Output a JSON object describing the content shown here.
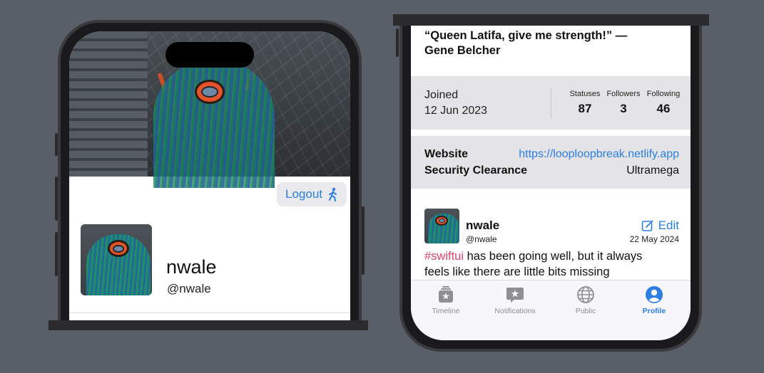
{
  "left": {
    "logout_label": "Logout",
    "profile_name": "nwale",
    "profile_handle": "@nwale"
  },
  "right": {
    "quote_line1": "“Queen Latifa, give me strength!” —",
    "quote_line2": "Gene Belcher",
    "joined_label": "Joined",
    "joined_date": "12 Jun 2023",
    "stats": [
      {
        "label": "Statuses",
        "value": "87"
      },
      {
        "label": "Followers",
        "value": "3"
      },
      {
        "label": "Following",
        "value": "46"
      }
    ],
    "fields": [
      {
        "key": "Website",
        "value": "https://looploopbreak.netlify.app"
      },
      {
        "key": "Security Clearance",
        "value": "Ultramega"
      }
    ],
    "post": {
      "author": "nwale",
      "handle": "@nwale",
      "edit_label": "Edit",
      "date": "22 May 2024",
      "hashtag": "#swiftui",
      "text": " has been going well, but it always feels like there are little bits missing"
    },
    "tabs": [
      {
        "label": "Timeline",
        "icon": "timeline-icon"
      },
      {
        "label": "Notifications",
        "icon": "notifications-icon"
      },
      {
        "label": "Public",
        "icon": "globe-icon"
      },
      {
        "label": "Profile",
        "icon": "person-icon"
      }
    ],
    "accent_color": "#2b7ee6",
    "hashtag_color": "#e0436a"
  }
}
